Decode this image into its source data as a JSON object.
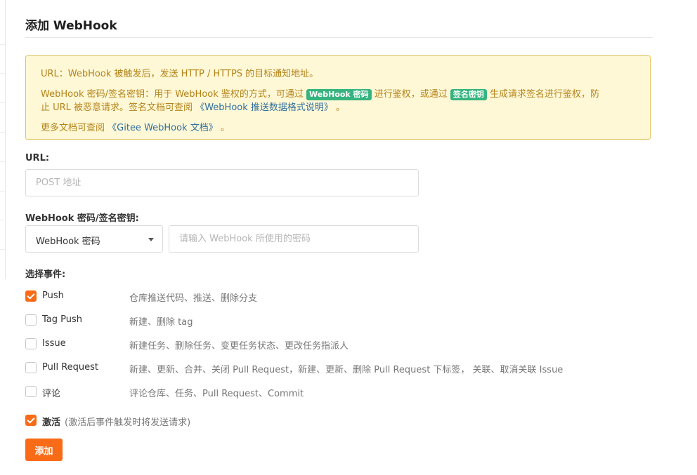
{
  "page": {
    "title": "添加 WebHook"
  },
  "notice": {
    "line1": "URL：WebHook 被触发后，发送 HTTP / HTTPS 的目标通知地址。",
    "line2_prefix": "WebHook 密码/签名密钥：用于 WebHook 鉴权的方式，可通过",
    "line2_badge1": "WebHook 密码",
    "line2_mid": "进行鉴权，或通过",
    "line2_badge2": "签名密钥",
    "line2_suffix": "生成请求签名进行鉴权，防",
    "line3_prefix": "止 URL 被恶意请求。签名文档可查阅",
    "line3_link": "《WebHook 推送数据格式说明》",
    "line3_suffix": "。",
    "line4_prefix": "更多文档可查阅",
    "line4_link": "《Gitee WebHook 文档》",
    "line4_suffix": "。",
    "colors": {
      "background": "#fff8d6",
      "border": "#e2c35a",
      "text": "#b3831a",
      "link": "#2f6f9f",
      "badge": "#36b37e"
    }
  },
  "url_field": {
    "label": "URL:",
    "placeholder": "POST 地址",
    "value": ""
  },
  "secret_field": {
    "label": "WebHook 密码/签名密钥:",
    "select_value": "WebHook 密码",
    "placeholder": "请输入 WebHook 所使用的密码",
    "value": ""
  },
  "events": {
    "label": "选择事件:",
    "items": [
      {
        "name": "Push",
        "desc": "仓库推送代码、推送、删除分支",
        "checked": true
      },
      {
        "name": "Tag Push",
        "desc": "新建、删除 tag",
        "checked": false
      },
      {
        "name": "Issue",
        "desc": "新建任务、删除任务、变更任务状态、更改任务指派人",
        "checked": false
      },
      {
        "name": "Pull Request",
        "desc": "新建、更新、合并、关闭 Pull Request，新建、更新、删除 Pull Request 下标签， 关联、取消关联 Issue",
        "checked": false
      },
      {
        "name": "评论",
        "desc": "评论仓库、任务、Pull Request、Commit",
        "checked": false
      }
    ]
  },
  "activate": {
    "label": "激活",
    "hint": "(激活后事件触发时将发送请求)",
    "checked": true
  },
  "submit": {
    "label": "添加"
  },
  "theme": {
    "accent": "#f96b17"
  },
  "icons": {
    "select_caret": "caret-down-icon",
    "checkbox_check": "check-icon"
  }
}
